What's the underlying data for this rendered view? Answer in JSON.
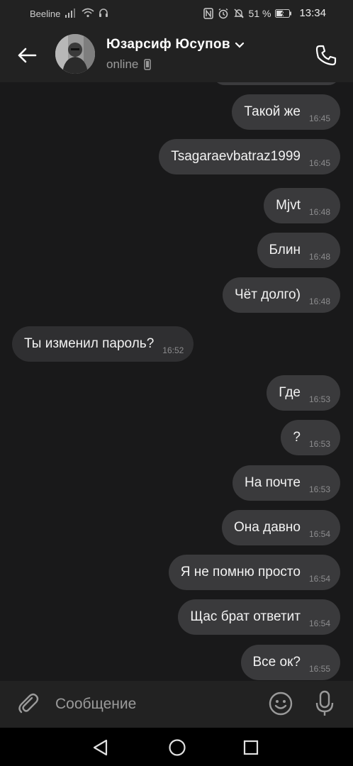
{
  "status_bar": {
    "carrier": "Beeline",
    "battery_percent": "51 %",
    "time": "13:34"
  },
  "header": {
    "contact_name": "Юзарсиф Юсупов",
    "status": "online"
  },
  "messages": [
    {
      "text": "Такой же",
      "time": "16:45",
      "direction": "out"
    },
    {
      "text": "Tsagaraevbatraz1999",
      "time": "16:45",
      "direction": "out"
    },
    {
      "text": "Mjvt",
      "time": "16:48",
      "direction": "out"
    },
    {
      "text": "Блин",
      "time": "16:48",
      "direction": "out"
    },
    {
      "text": "Чёт долго)",
      "time": "16:48",
      "direction": "out"
    },
    {
      "text": "Ты изменил пароль?",
      "time": "16:52",
      "direction": "in"
    },
    {
      "text": "Где",
      "time": "16:53",
      "direction": "out"
    },
    {
      "text": "?",
      "time": "16:53",
      "direction": "out"
    },
    {
      "text": "На почте",
      "time": "16:53",
      "direction": "out"
    },
    {
      "text": "Она давно",
      "time": "16:54",
      "direction": "out"
    },
    {
      "text": "Я не помню просто",
      "time": "16:54",
      "direction": "out"
    },
    {
      "text": "Щас брат ответит",
      "time": "16:54",
      "direction": "out"
    },
    {
      "text": "Все ок?",
      "time": "16:55",
      "direction": "out"
    }
  ],
  "composer": {
    "placeholder": "Сообщение"
  },
  "icons": {
    "back": "arrow-left-icon",
    "call": "phone-icon",
    "attach": "paperclip-icon",
    "emoji": "smiley-icon",
    "mic": "microphone-icon"
  }
}
